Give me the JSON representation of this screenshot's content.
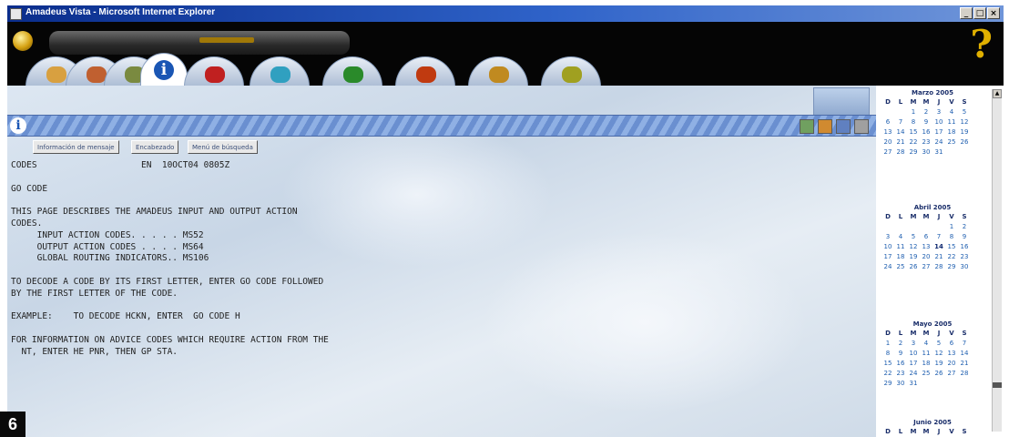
{
  "window": {
    "title": "Amadeus Vista - Microsoft Internet Explorer"
  },
  "header": {
    "icons": [
      "globe-logo-icon",
      "help-question-icon"
    ],
    "tabs": [
      {
        "icon": "tab-icon-1",
        "color": "#d8a040"
      },
      {
        "icon": "tab-icon-2",
        "color": "#c06030"
      },
      {
        "icon": "tab-icon-3",
        "color": "#7a8a40"
      },
      {
        "icon": "info-icon",
        "label": "i",
        "active": true
      },
      {
        "icon": "tab-icon-5",
        "color": "#c02020"
      },
      {
        "icon": "tab-icon-6",
        "color": "#30a0c0"
      },
      {
        "icon": "tab-icon-7",
        "color": "#2a8a2a"
      },
      {
        "icon": "tab-icon-8",
        "color": "#c03a10"
      },
      {
        "icon": "tab-icon-9",
        "color": "#c08a20"
      },
      {
        "icon": "tab-icon-10",
        "color": "#a0a020"
      }
    ]
  },
  "command": {
    "info_glyph": "i",
    "value": "",
    "icons": [
      {
        "name": "tool-icon-1",
        "color": "#70a060"
      },
      {
        "name": "tool-icon-2",
        "color": "#d08a30"
      },
      {
        "name": "tool-icon-3",
        "color": "#6080c0"
      },
      {
        "name": "tool-icon-4",
        "color": "#a0a0a0"
      }
    ]
  },
  "subtabs": [
    "Información de mensaje",
    "Encabezado",
    "Menú de búsqueda"
  ],
  "terminal": {
    "lines": [
      "CODES                    EN  10OCT04 0805Z",
      "",
      "GO CODE",
      "",
      "THIS PAGE DESCRIBES THE AMADEUS INPUT AND OUTPUT ACTION",
      "CODES.",
      "     INPUT ACTION CODES. . . . . MS52",
      "     OUTPUT ACTION CODES . . . . MS64",
      "     GLOBAL ROUTING INDICATORS.. MS106",
      "",
      "TO DECODE A CODE BY ITS FIRST LETTER, ENTER GO CODE FOLLOWED",
      "BY THE FIRST LETTER OF THE CODE.",
      "",
      "EXAMPLE:    TO DECODE HCKN, ENTER  GO CODE H",
      "",
      "FOR INFORMATION ON ADVICE CODES WHICH REQUIRE ACTION FROM THE",
      "  NT, ENTER HE PNR, THEN GP STA."
    ]
  },
  "calendar": {
    "weekdays": [
      "D",
      "L",
      "M",
      "M",
      "J",
      "V",
      "S"
    ],
    "months": [
      {
        "title": "Marzo 2005",
        "weeks": [
          [
            "",
            "",
            "1",
            "2",
            "3",
            "4",
            "5"
          ],
          [
            "6",
            "7",
            "8",
            "9",
            "10",
            "11",
            "12"
          ],
          [
            "13",
            "14",
            "15",
            "16",
            "17",
            "18",
            "19"
          ],
          [
            "20",
            "21",
            "22",
            "23",
            "24",
            "25",
            "26"
          ],
          [
            "27",
            "28",
            "29",
            "30",
            "31",
            "",
            ""
          ]
        ]
      },
      {
        "title": "Abril 2005",
        "weeks": [
          [
            "",
            "",
            "",
            "",
            "",
            "1",
            "2"
          ],
          [
            "3",
            "4",
            "5",
            "6",
            "7",
            "8",
            "9"
          ],
          [
            "10",
            "11",
            "12",
            "13",
            "14",
            "15",
            "16"
          ],
          [
            "17",
            "18",
            "19",
            "20",
            "21",
            "22",
            "23"
          ],
          [
            "24",
            "25",
            "26",
            "27",
            "28",
            "29",
            "30"
          ]
        ]
      },
      {
        "title": "Mayo 2005",
        "weeks": [
          [
            "1",
            "2",
            "3",
            "4",
            "5",
            "6",
            "7"
          ],
          [
            "8",
            "9",
            "10",
            "11",
            "12",
            "13",
            "14"
          ],
          [
            "15",
            "16",
            "17",
            "18",
            "19",
            "20",
            "21"
          ],
          [
            "22",
            "23",
            "24",
            "25",
            "26",
            "27",
            "28"
          ],
          [
            "29",
            "30",
            "31",
            "",
            "",
            "",
            ""
          ]
        ]
      },
      {
        "title": "Junio 2005",
        "weeks": []
      }
    ],
    "highlight": {
      "month": 1,
      "day": "14"
    }
  },
  "badge": "6"
}
